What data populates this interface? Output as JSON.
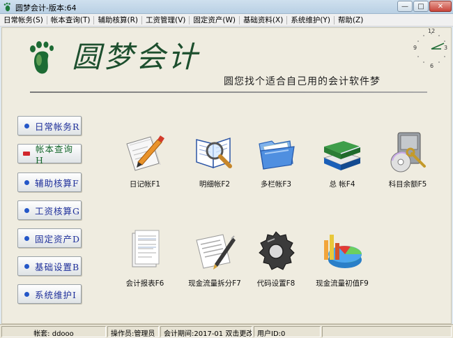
{
  "window": {
    "title": "圆梦会计-版本:64"
  },
  "menu": [
    "日常帐务(S)",
    "帐本查询(T)",
    "辅助核算(R)",
    "工资管理(V)",
    "固定资产(W)",
    "基础资料(X)",
    "系统维护(Y)",
    "帮助(Z)"
  ],
  "header": {
    "logo_text": "圆梦会计",
    "slogan": "圆您找个适合自己用的会计软件梦",
    "clock": {
      "n12": "12",
      "n3": "3",
      "n6": "6",
      "n9": "9"
    }
  },
  "sidebar": [
    {
      "label": "日常帐务R"
    },
    {
      "label": "帐本查询H"
    },
    {
      "label": "辅助核算F"
    },
    {
      "label": "工资核算G"
    },
    {
      "label": "固定资产D"
    },
    {
      "label": "基础设置B"
    },
    {
      "label": "系统维护I"
    }
  ],
  "tools": [
    {
      "label": "日记帐F1",
      "icon": "journal-pen-icon"
    },
    {
      "label": "明细帐F2",
      "icon": "magnifier-book-icon"
    },
    {
      "label": "多栏帐F3",
      "icon": "blue-folder-icon"
    },
    {
      "label": "总 帐F4",
      "icon": "stacked-books-icon"
    },
    {
      "label": "科目余额F5",
      "icon": "safe-disc-icon"
    },
    {
      "label": "会计报表F6",
      "icon": "report-document-icon"
    },
    {
      "label": "现金流量拆分F7",
      "icon": "pen-document-icon"
    },
    {
      "label": "代码设置F8",
      "icon": "gear-icon"
    },
    {
      "label": "现金流量初值F9",
      "icon": "pie-chart-icon"
    }
  ],
  "status": {
    "account": "帐套: ddooo",
    "operator": "操作员:管理员",
    "period": "会计期间:2017-01  双击更改",
    "user_id": "用户ID:0"
  },
  "colors": {
    "accent": "#1e2f9a",
    "active": "#14662a",
    "logo": "#1d4f2e"
  }
}
